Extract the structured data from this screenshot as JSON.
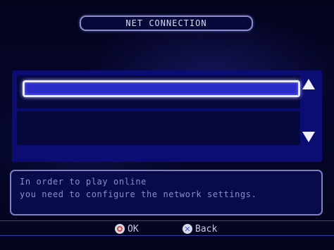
{
  "header": {
    "title": "NET CONNECTION"
  },
  "message": {
    "line1": "In order to play online",
    "line2": "you need to configure the network settings."
  },
  "footer": {
    "ok_label": "OK",
    "back_label": "Back"
  },
  "icons": {
    "ok": "circle-button-icon",
    "back": "cross-button-icon",
    "scroll_up": "arrow-up-icon",
    "scroll_down": "arrow-down-icon"
  },
  "colors": {
    "panel": "#0c0d72",
    "selection": "#2a2bc8",
    "text": "#d8d9f2"
  }
}
